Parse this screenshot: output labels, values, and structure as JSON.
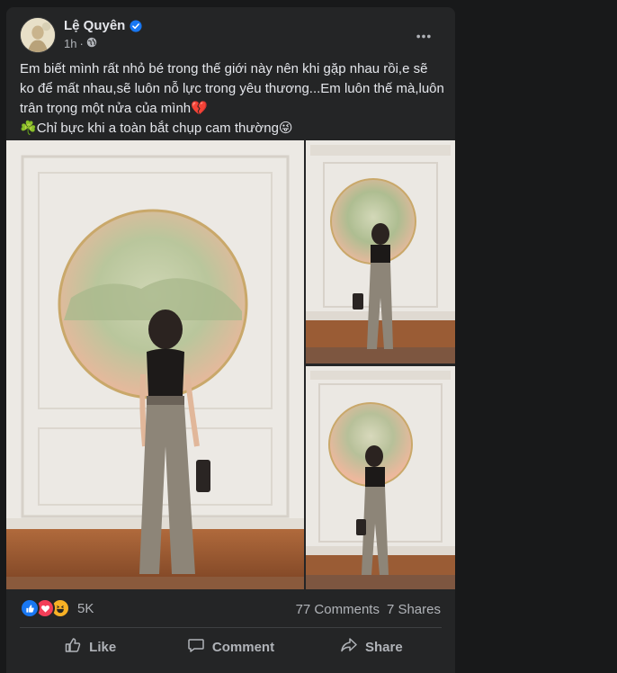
{
  "post": {
    "author": "Lệ Quyên",
    "time": "1h",
    "text_line1": "Em biết mình rất nhỏ bé trong thế giới này nên khi gặp nhau rồi,e sẽ ko để mất nhau,sẽ luôn nỗ lực trong yêu thương...Em luôn thế mà,luôn trân trọng một nửa của mình💔",
    "text_line2": "Chỉ bực khi a toàn bắt chụp cam thường😜",
    "clover": "☘️"
  },
  "stats": {
    "reaction_count": "5K",
    "comments": "77 Comments",
    "shares": "7 Shares"
  },
  "actions": {
    "like": "Like",
    "comment": "Comment",
    "share": "Share"
  },
  "colors": {
    "background": "#18191a",
    "card": "#242526",
    "text": "#e4e6eb",
    "secondary": "#b0b3b8",
    "like_blue": "#1877f2",
    "love_red": "#f33e58",
    "haha_yellow": "#f7b125"
  },
  "icons": [
    "verified-badge-icon",
    "globe-icon",
    "more-options-icon",
    "like-reaction-icon",
    "love-reaction-icon",
    "haha-reaction-icon",
    "like-icon",
    "comment-icon",
    "share-icon"
  ]
}
